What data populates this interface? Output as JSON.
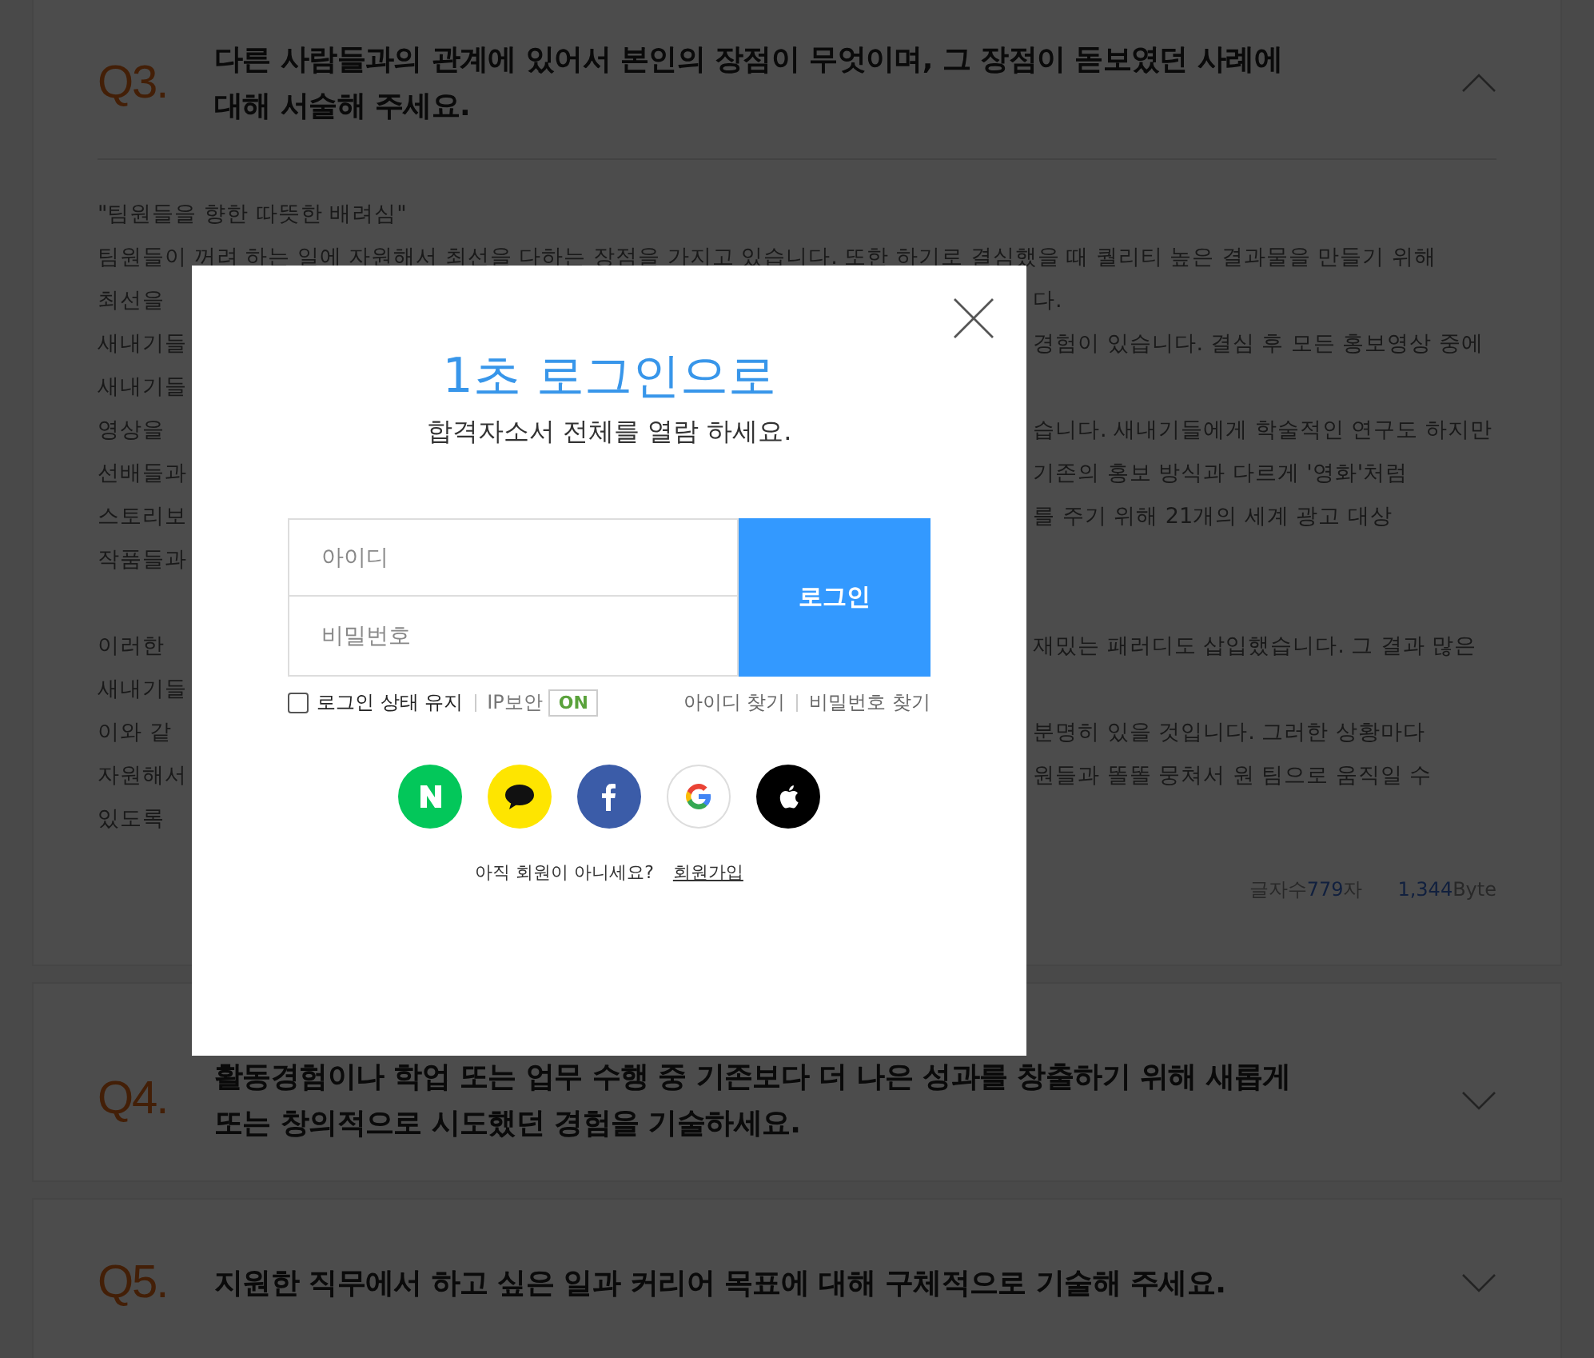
{
  "questions": [
    {
      "number": "Q3.",
      "title_lines": [
        "다른 사람들과의 관계에 있어서 본인의 장점이 무엇이며, 그 장점이 돋보였던 사례에",
        "대해 서술해 주세요."
      ],
      "expanded": true,
      "answer": {
        "paragraphs": [
          [
            {
              "left": "\"팀원들을 향한 따뜻한 배려심\""
            },
            {
              "left": "팀원들이 꺼려 하는 일에 자원해서 최선을 다하는 장점을 가지고 있습니다. 또한 하기로 결심했을 때 퀄리티 높은 결과물을 만들기 위해"
            },
            {
              "left": "최선을",
              "right": "다."
            },
            {
              "left": "새내기들",
              "right": "경험이 있습니다. 결심 후 모든 홍보영상 중에"
            },
            {
              "left": "새내기들"
            },
            {
              "left": "영상을",
              "right": "습니다. 새내기들에게 학술적인 연구도 하지만"
            },
            {
              "left": "선배들과",
              "right": "기존의 홍보 방식과 다르게 '영화'처럼"
            },
            {
              "left": "스토리보",
              "right": "를 주기 위해 21개의 세계 광고 대상"
            },
            {
              "left": "작품들과"
            }
          ],
          [
            {
              "left": "이러한",
              "right": "재밌는 패러디도 삽입했습니다. 그 결과 많은"
            },
            {
              "left": "새내기들"
            },
            {
              "left": "이와 같",
              "right": "분명히 있을 것입니다. 그러한 상황마다"
            },
            {
              "left": "자원해서",
              "right": "원들과 똘똘 뭉쳐서 원 팀으로 움직일 수"
            },
            {
              "left": "있도록"
            }
          ]
        ],
        "stats": {
          "chars_label": "글자수",
          "chars": "779",
          "chars_unit": "자",
          "bytes": "1,344",
          "bytes_unit": "Byte"
        }
      }
    },
    {
      "number": "Q4.",
      "title_lines": [
        "활동경험이나 학업 또는 업무 수행 중 기존보다 더 나은 성과를 창출하기 위해 새롭게",
        "또는 창의적으로 시도했던 경험을 기술하세요."
      ],
      "expanded": false
    },
    {
      "number": "Q5.",
      "title_lines": [
        "지원한 직무에서 하고 싶은 일과 커리어 목표에 대해 구체적으로 기술해 주세요."
      ],
      "expanded": false
    }
  ],
  "login_modal": {
    "title": "1초 로그인으로",
    "subtitle": "합격자소서 전체를 열람 하세요.",
    "id_field": {
      "placeholder": "아이디"
    },
    "password_field": {
      "placeholder": "비밀번호"
    },
    "login_button": "로그인",
    "keep_login": {
      "label": "로그인 상태 유지",
      "checked": false
    },
    "ip_security": {
      "label": "IP보안",
      "badge": "ON",
      "on": true
    },
    "links": [
      "아이디 찾기",
      "비밀번호 찾기"
    ],
    "social": [
      {
        "kind": "naver"
      },
      {
        "kind": "kakao"
      },
      {
        "kind": "facebook"
      },
      {
        "kind": "google"
      },
      {
        "kind": "apple"
      }
    ],
    "signup_prompt": "아직 회원이 아니세요?",
    "signup_link": "회원가입"
  }
}
